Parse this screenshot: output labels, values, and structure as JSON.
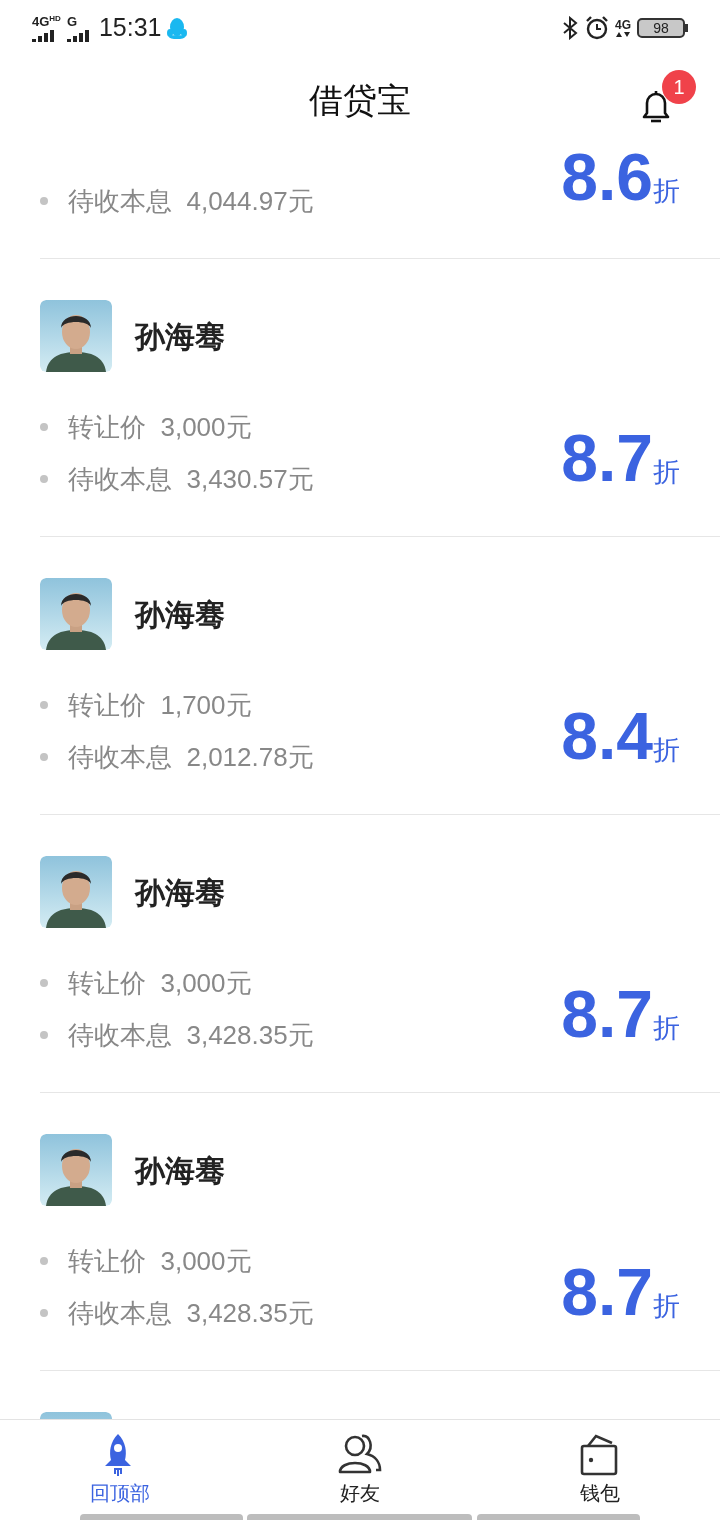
{
  "status_bar": {
    "network_1": "4G",
    "network_1_badge": "HD",
    "network_2": "G",
    "time": "15:31",
    "network_3": "4G",
    "battery": "98"
  },
  "header": {
    "title": "借贷宝",
    "notification_badge": "1"
  },
  "listings": [
    {
      "kind": "partial",
      "lines": [
        {
          "label": "待收本息",
          "value": "4,044.97元"
        }
      ],
      "discount": "8.6",
      "discount_unit": "折"
    },
    {
      "kind": "full",
      "name": "孙海骞",
      "lines": [
        {
          "label": "转让价",
          "value": "3,000元"
        },
        {
          "label": "待收本息",
          "value": "3,430.57元"
        }
      ],
      "discount": "8.7",
      "discount_unit": "折"
    },
    {
      "kind": "full",
      "name": "孙海骞",
      "lines": [
        {
          "label": "转让价",
          "value": "1,700元"
        },
        {
          "label": "待收本息",
          "value": "2,012.78元"
        }
      ],
      "discount": "8.4",
      "discount_unit": "折"
    },
    {
      "kind": "full",
      "name": "孙海骞",
      "lines": [
        {
          "label": "转让价",
          "value": "3,000元"
        },
        {
          "label": "待收本息",
          "value": "3,428.35元"
        }
      ],
      "discount": "8.7",
      "discount_unit": "折"
    },
    {
      "kind": "full",
      "name": "孙海骞",
      "lines": [
        {
          "label": "转让价",
          "value": "3,000元"
        },
        {
          "label": "待收本息",
          "value": "3,428.35元"
        }
      ],
      "discount": "8.7",
      "discount_unit": "折"
    }
  ],
  "tab_bar": [
    {
      "kind": "rocket",
      "label": "回顶部",
      "selected": true
    },
    {
      "kind": "friends",
      "label": "好友",
      "selected": false
    },
    {
      "kind": "wallet",
      "label": "钱包",
      "selected": false
    }
  ]
}
